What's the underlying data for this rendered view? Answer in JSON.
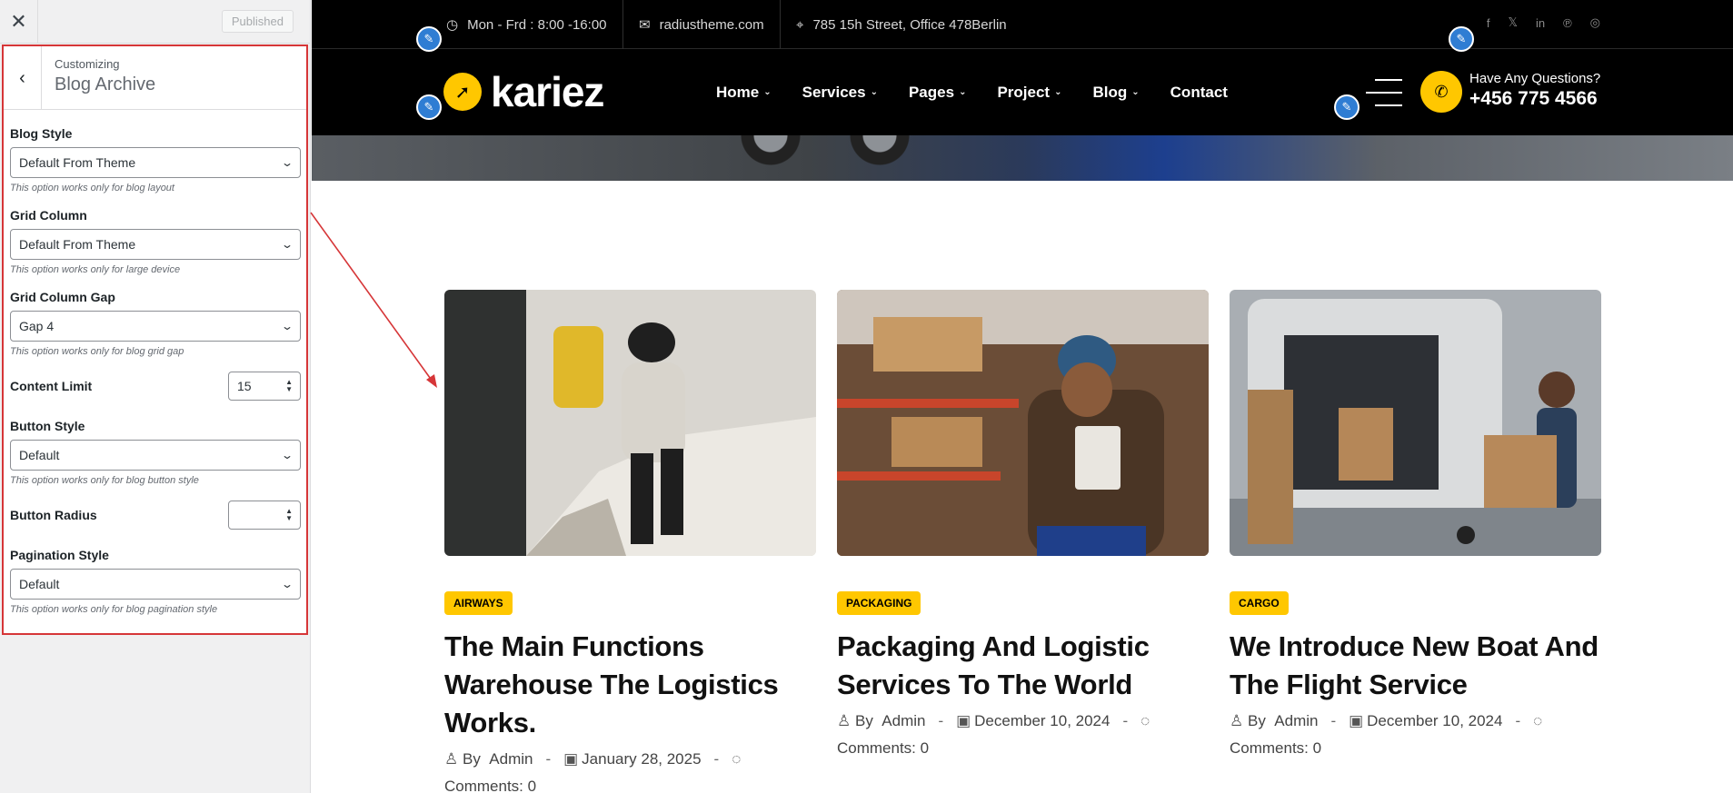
{
  "customizer": {
    "published_label": "Published",
    "breadcrumb": "Customizing",
    "section_title": "Blog Archive",
    "fields": {
      "blog_style": {
        "label": "Blog Style",
        "value": "Default From Theme",
        "desc": "This option works only for blog layout"
      },
      "grid_column": {
        "label": "Grid Column",
        "value": "Default From Theme",
        "desc": "This option works only for large device"
      },
      "grid_gap": {
        "label": "Grid Column Gap",
        "value": "Gap 4",
        "desc": "This option works only for blog grid gap"
      },
      "content_limit": {
        "label": "Content Limit",
        "value": "15"
      },
      "button_style": {
        "label": "Button Style",
        "value": "Default",
        "desc": "This option works only for blog button style"
      },
      "button_radius": {
        "label": "Button Radius",
        "value": ""
      },
      "pagination_style": {
        "label": "Pagination Style",
        "value": "Default",
        "desc": "This option works only for blog pagination style"
      }
    }
  },
  "site": {
    "topbar": {
      "hours": "Mon - Frd : 8:00 -16:00",
      "email": "radiustheme.com",
      "address": "785 15h Street, Office 478Berlin"
    },
    "logo_text": "kariez",
    "menu": {
      "home": "Home",
      "services": "Services",
      "pages": "Pages",
      "project": "Project",
      "blog": "Blog",
      "contact": "Contact"
    },
    "phone_question": "Have Any Questions?",
    "phone_number": "+456 775 4566"
  },
  "posts": [
    {
      "tag": "AIRWAYS",
      "title": "The Main Functions Warehouse The Logistics Works.",
      "by": "By",
      "author": "Admin",
      "date": "January 28, 2025",
      "comments": "Comments: 0"
    },
    {
      "tag": "PACKAGING",
      "title": "Packaging And Logistic Services To The World",
      "by": "By",
      "author": "Admin",
      "date": "December 10, 2024",
      "comments": "Comments: 0"
    },
    {
      "tag": "CARGO",
      "title": "We Introduce New Boat And The Flight Service",
      "by": "By",
      "author": "Admin",
      "date": "December 10, 2024",
      "comments": "Comments: 0"
    }
  ],
  "colors": {
    "accent": "#ffc700",
    "highlight": "#d63638",
    "edit_shortcut": "#2f7dd3"
  }
}
